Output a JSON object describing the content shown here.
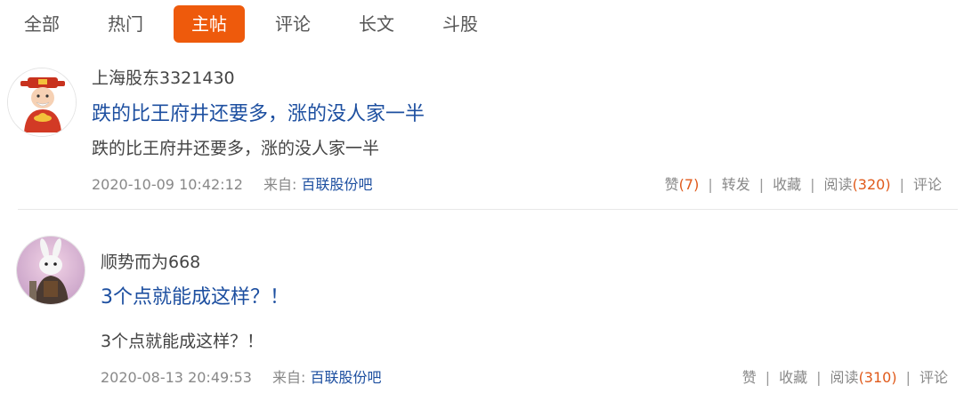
{
  "tabs": [
    {
      "label": "全部"
    },
    {
      "label": "热门"
    },
    {
      "label": "主帖"
    },
    {
      "label": "评论"
    },
    {
      "label": "长文"
    },
    {
      "label": "斗股"
    }
  ],
  "active_tab": "主帖",
  "colors": {
    "accent": "#ee5a0c",
    "link": "#1d4fa0",
    "count": "#e05a1b"
  },
  "posts": [
    {
      "author": "上海股东3321430",
      "title": "跌的比王府井还要多，涨的没人家一半",
      "excerpt": "跌的比王府井还要多，涨的没人家一半",
      "time": "2020-10-09 10:42:12",
      "from_label": "来自:",
      "forum": "百联股份吧",
      "like_label": "赞",
      "like_count": "(7)",
      "forward_label": "转发",
      "fav_label": "收藏",
      "read_label": "阅读",
      "read_count": "(320)",
      "comment_label": "评论",
      "avatar_icon": "fortune-god-avatar"
    },
    {
      "author": "顺势而为668",
      "title": "3个点就能成这样？！",
      "excerpt": "3个点就能成这样？！",
      "time": "2020-08-13 20:49:53",
      "from_label": "来自:",
      "forum": "百联股份吧",
      "like_label": "赞",
      "fav_label": "收藏",
      "read_label": "阅读",
      "read_count": "(310)",
      "comment_label": "评论",
      "avatar_icon": "rabbit-warrior-avatar"
    }
  ]
}
